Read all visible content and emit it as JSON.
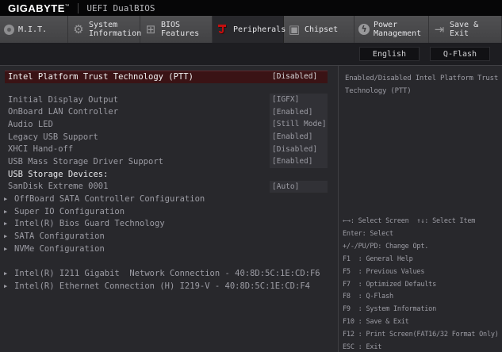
{
  "titlebar": {
    "brand": "GIGABYTE",
    "trademark": "™",
    "edition": "UEFI DualBIOS"
  },
  "tabs": [
    {
      "label": "M.I.T.",
      "icon": "dial-icon",
      "active": false
    },
    {
      "label": "System Information",
      "icon": "gear-icon",
      "active": false
    },
    {
      "label": "BIOS Features",
      "icon": "bios-icon",
      "active": false
    },
    {
      "label": "Peripherals",
      "icon": "peripherals-icon",
      "active": true
    },
    {
      "label": "Chipset",
      "icon": "chipset-icon",
      "active": false
    },
    {
      "label": "Power Management",
      "icon": "power-icon",
      "active": false
    },
    {
      "label": "Save & Exit",
      "icon": "exit-icon",
      "active": false
    }
  ],
  "quick_buttons": [
    {
      "label": "English"
    },
    {
      "label": "Q-Flash"
    }
  ],
  "settings": {
    "rows": [
      {
        "type": "setting",
        "label": "Intel Platform Trust Technology (PTT)",
        "value": "[Disabled]",
        "selected": true
      },
      {
        "type": "spacer",
        "size": "sm"
      },
      {
        "type": "setting",
        "label": "Initial Display Output",
        "value": "[IGFX]",
        "boxed": true
      },
      {
        "type": "setting",
        "label": "OnBoard LAN Controller",
        "value": "[Enabled]",
        "boxed": true
      },
      {
        "type": "setting",
        "label": "Audio LED",
        "value": "[Still Mode]",
        "boxed": true
      },
      {
        "type": "setting",
        "label": "Legacy USB Support",
        "value": "[Enabled]",
        "boxed": true
      },
      {
        "type": "setting",
        "label": "XHCI Hand-off",
        "value": "[Disabled]",
        "boxed": true
      },
      {
        "type": "setting",
        "label": "USB Mass Storage Driver Support",
        "value": "[Enabled]",
        "boxed": true
      },
      {
        "type": "section",
        "label": "USB Storage Devices:"
      },
      {
        "type": "setting",
        "label": "SanDisk Extreme 0001",
        "value": "[Auto]",
        "boxed": true
      },
      {
        "type": "submenu",
        "label": "OffBoard SATA Controller Configuration"
      },
      {
        "type": "submenu",
        "label": "Super IO Configuration"
      },
      {
        "type": "submenu",
        "label": "Intel(R) Bios Guard Technology"
      },
      {
        "type": "submenu",
        "label": "SATA Configuration"
      },
      {
        "type": "submenu",
        "label": "NVMe Configuration"
      },
      {
        "type": "spacer",
        "size": "lg"
      },
      {
        "type": "submenu",
        "label": "Intel(R) I211 Gigabit  Network Connection - 40:8D:5C:1E:CD:F6"
      },
      {
        "type": "submenu",
        "label": "Intel(R) Ethernet Connection (H) I219-V - 40:8D:5C:1E:CD:F4"
      }
    ]
  },
  "help": {
    "description": "Enabled/Disabled Intel Platform Trust Technology (PTT)",
    "keys": [
      "←→: Select Screen  ↑↓: Select Item",
      "Enter: Select",
      "+/-/PU/PD: Change Opt.",
      "F1  : General Help",
      "F5  : Previous Values",
      "F7  : Optimized Defaults",
      "F8  : Q-Flash",
      "F9  : System Information",
      "F10 : Save & Exit",
      "F12 : Print Screen(FAT16/32 Format Only)",
      "ESC : Exit"
    ]
  },
  "colors": {
    "accent_red": "#c40f0f",
    "selected_row_bg": "#3a1315",
    "value_box_bg": "#313136"
  }
}
